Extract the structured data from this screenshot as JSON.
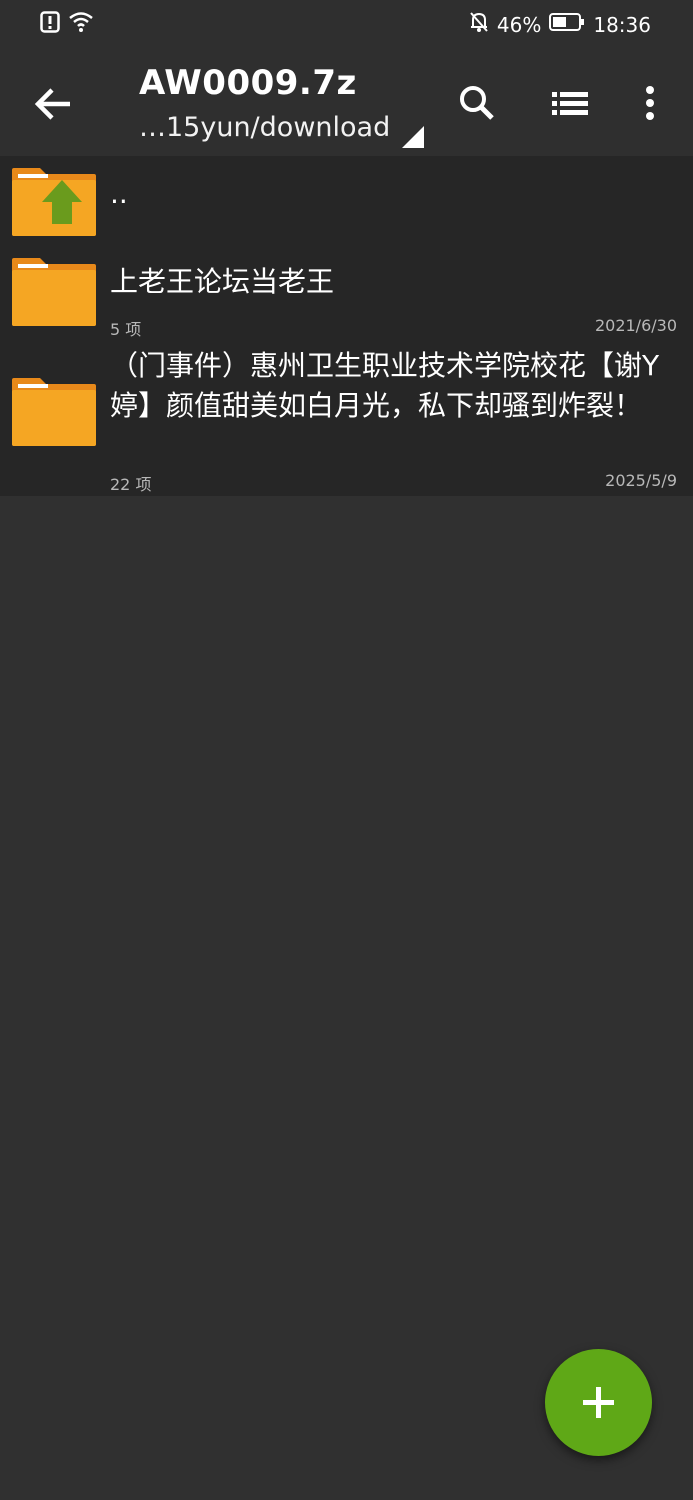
{
  "status_bar": {
    "battery_percent": "46%",
    "time": "18:36",
    "icons": [
      "alert-icon",
      "wifi-icon",
      "bell-off-icon",
      "battery-icon"
    ]
  },
  "app_bar": {
    "title": "AW0009.7z",
    "path": "…15yun/download",
    "icons": [
      "back-arrow-icon",
      "search-icon",
      "list-view-icon",
      "more-vert-icon"
    ]
  },
  "files": {
    "parent": {
      "name": ".."
    },
    "items": [
      {
        "name": "上老王论坛当老王",
        "count": "5 项",
        "date": "2021/6/30"
      },
      {
        "name": "（门事件）惠州卫生职业技术学院校花【谢Y婷】颜值甜美如白月光，私下却骚到炸裂！",
        "count": "22 项",
        "date": "2025/5/9"
      }
    ]
  },
  "colors": {
    "background": "#303030",
    "bar": "#2f2f2f",
    "row": "#262626",
    "folder": "#f5a623",
    "fab": "#5fa817",
    "up_arrow": "#6a9b1d"
  },
  "fab": {
    "icon": "plus-icon"
  }
}
